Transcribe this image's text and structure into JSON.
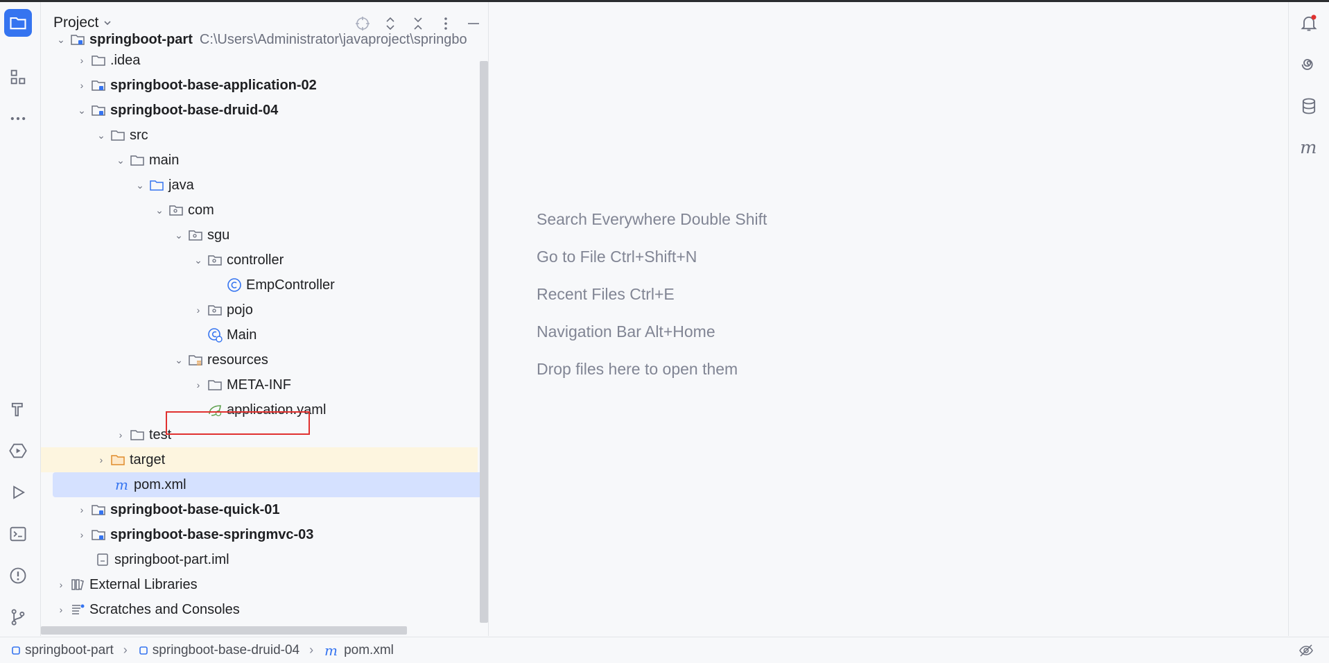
{
  "project_pane": {
    "title": "Project",
    "tree": [
      {
        "label": "springboot-part",
        "path": "C:\\Users\\Administrator\\javaproject\\springbo",
        "bold": true
      },
      {
        "label": ".idea"
      },
      {
        "label": "springboot-base-application-02",
        "bold": true
      },
      {
        "label": "springboot-base-druid-04",
        "bold": true
      },
      {
        "label": "src"
      },
      {
        "label": "main"
      },
      {
        "label": "java"
      },
      {
        "label": "com"
      },
      {
        "label": "sgu"
      },
      {
        "label": "controller"
      },
      {
        "label": "EmpController"
      },
      {
        "label": "pojo"
      },
      {
        "label": "Main"
      },
      {
        "label": "resources"
      },
      {
        "label": "META-INF"
      },
      {
        "label": "application.yaml"
      },
      {
        "label": "test"
      },
      {
        "label": "target"
      },
      {
        "label": "pom.xml"
      },
      {
        "label": "springboot-base-quick-01",
        "bold": true
      },
      {
        "label": "springboot-base-springmvc-03",
        "bold": true
      },
      {
        "label": "springboot-part.iml"
      },
      {
        "label": "External Libraries"
      },
      {
        "label": "Scratches and Consoles"
      }
    ]
  },
  "editor": {
    "hints": [
      "Search Everywhere Double Shift",
      "Go to File Ctrl+Shift+N",
      "Recent Files Ctrl+E",
      "Navigation Bar Alt+Home",
      "Drop files here to open them"
    ]
  },
  "statusbar": {
    "breadcrumbs": [
      "springboot-part",
      "springboot-base-druid-04",
      "pom.xml"
    ]
  },
  "colors": {
    "accent": "#3574f0",
    "highlight_border": "#e0312f",
    "selection": "#d5e1ff",
    "excluded_row": "#fdf5df"
  }
}
